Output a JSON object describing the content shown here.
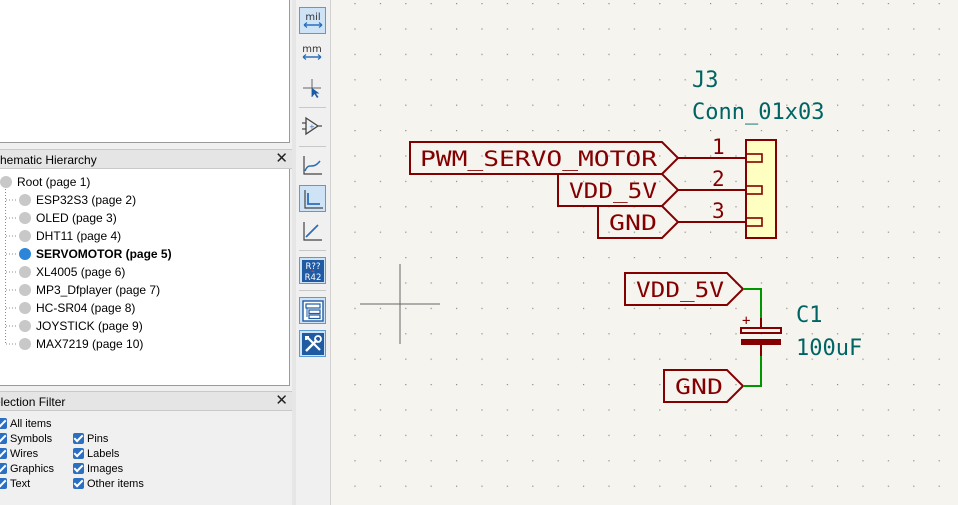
{
  "hierarchy_panel": {
    "title": "chematic Hierarchy",
    "close": "✕",
    "items": [
      {
        "label": "Root (page 1)"
      },
      {
        "label": "ESP32S3 (page 2)"
      },
      {
        "label": "OLED (page 3)"
      },
      {
        "label": "DHT11 (page 4)"
      },
      {
        "label": "SERVOMOTOR (page 5)"
      },
      {
        "label": "XL4005 (page 6)"
      },
      {
        "label": "MP3_Dfplayer (page 7)"
      },
      {
        "label": "HC-SR04 (page 8)"
      },
      {
        "label": "JOYSTICK (page 9)"
      },
      {
        "label": "MAX7219 (page 10)"
      }
    ],
    "active_item": "SERVOMOTOR (page 5)"
  },
  "selection_filter": {
    "title": "election Filter",
    "close": "✕",
    "all_items": "All items",
    "col1": [
      "Symbols",
      "Wires",
      "Graphics",
      "Text"
    ],
    "col2": [
      "Pins",
      "Labels",
      "Images",
      "Other items"
    ]
  },
  "toolbar": {
    "mil_label": "mil",
    "mm_label": "mm",
    "annotate_top": "R??",
    "annotate_bottom": "R42"
  },
  "schematic": {
    "connector": {
      "reference": "J3",
      "value": "Conn_01x03",
      "pins": [
        "1",
        "2",
        "3"
      ]
    },
    "labels_connector": [
      "PWM_SERVO_MOTOR",
      "VDD_5V",
      "GND"
    ],
    "capacitor": {
      "reference": "C1",
      "value": "100uF",
      "polarity": "+"
    },
    "labels_capacitor": [
      "VDD_5V",
      "GND"
    ],
    "colors": {
      "label": "#840000",
      "reference": "#006464",
      "wire": "#009600",
      "connector_fill": "#ffffc2",
      "background": "#f5f4ef"
    }
  }
}
